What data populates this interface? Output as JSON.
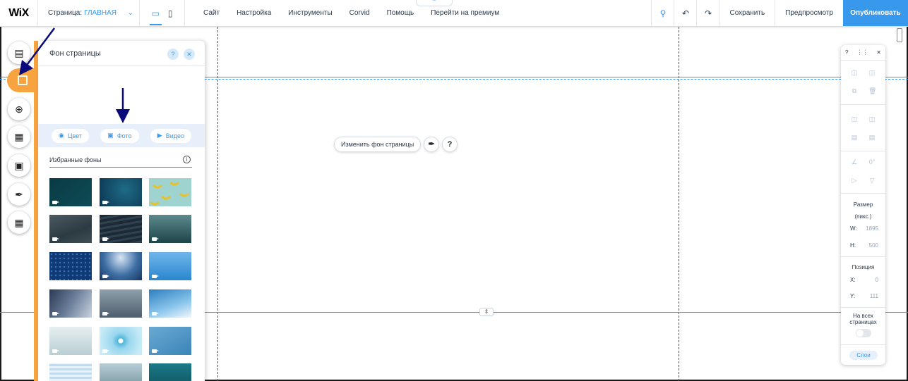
{
  "topbar": {
    "logo": "WiX",
    "page_label": "Страница:",
    "page_name": "ГЛАВНАЯ",
    "menu": [
      "Сайт",
      "Настройка",
      "Инструменты",
      "Corvid",
      "Помощь",
      "Перейти на премиум"
    ],
    "save": "Сохранить",
    "preview": "Предпросмотр",
    "publish": "Опубликовать"
  },
  "panel": {
    "title": "Фон страницы",
    "help": "?",
    "tabs": {
      "color": "Цвет",
      "photo": "Фото",
      "video": "Видео"
    },
    "favorites_title": "Избранные фоны"
  },
  "canvas": {
    "change_bg": "Изменить фон страницы",
    "help": "?"
  },
  "right_panel": {
    "help": "?",
    "size_label": "Размер",
    "size_unit": "(пикс.)",
    "w_label": "W:",
    "w_value": "1895",
    "h_label": "H:",
    "h_value": "500",
    "rotation": "0°",
    "position_label": "Позиция",
    "x_label": "X:",
    "x_value": "0",
    "y_label": "Y:",
    "y_value": "111",
    "all_pages_line1": "На всех",
    "all_pages_line2": "страницах",
    "layers": "Слои"
  },
  "colors": {
    "accent": "#3899ec",
    "orange": "#f7a440",
    "arrow": "#0a0a7a"
  }
}
